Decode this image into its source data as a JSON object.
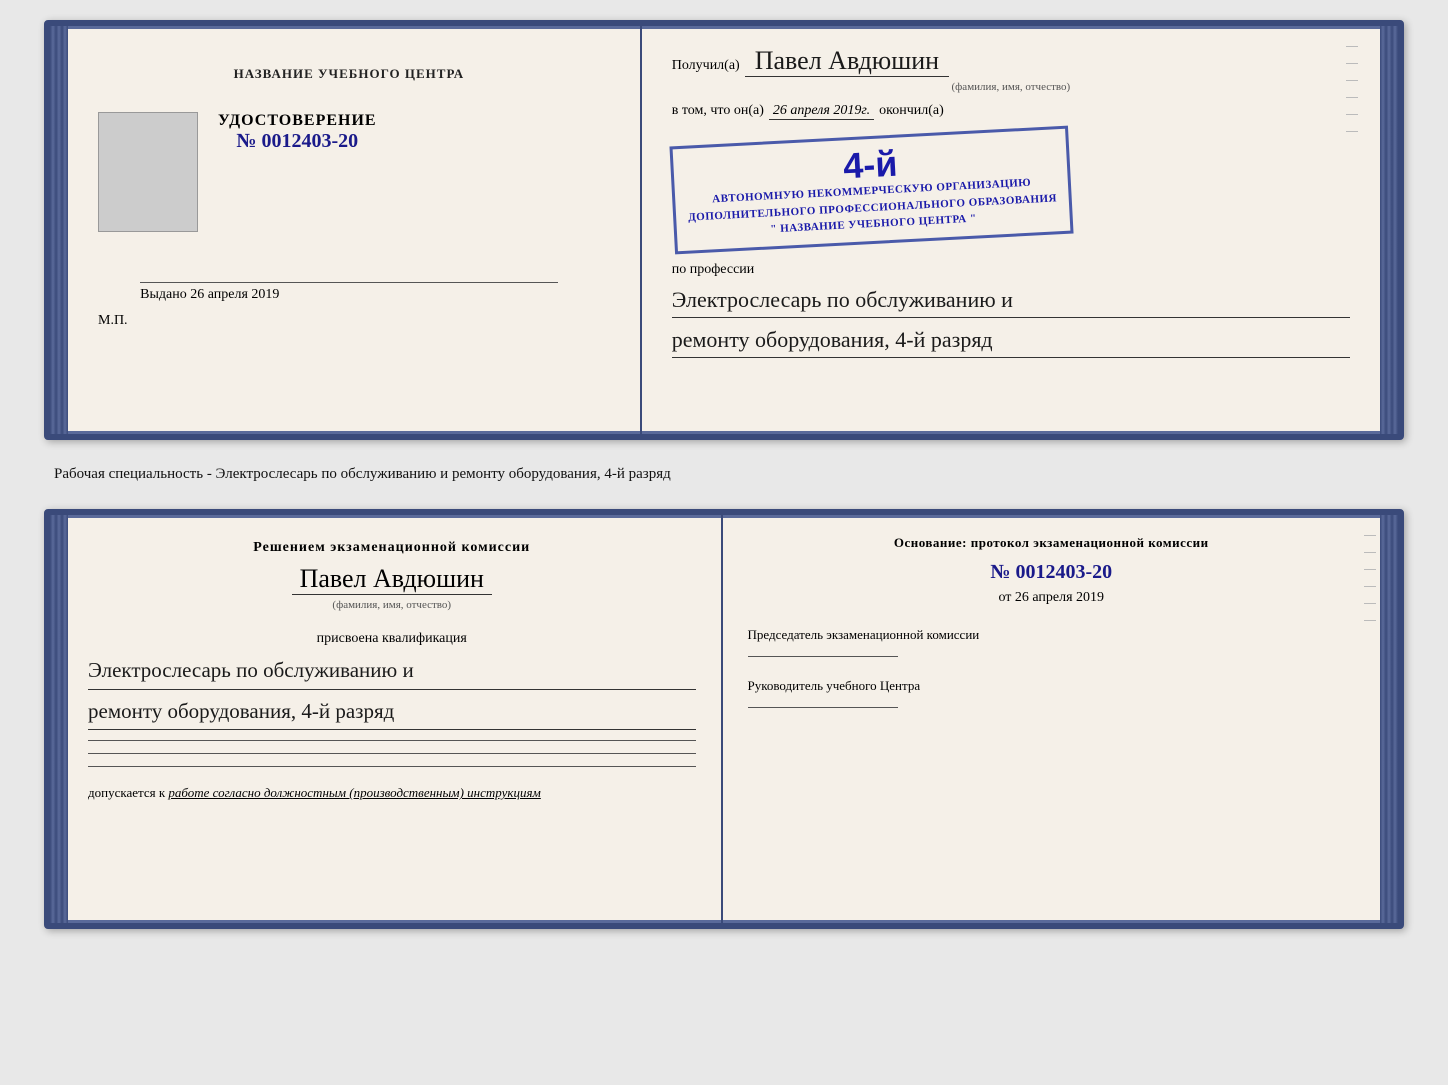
{
  "top_card": {
    "left": {
      "center_title": "НАЗВАНИЕ УЧЕБНОГО ЦЕНТРА",
      "udostoverenie_title": "УДОСТОВЕРЕНИЕ",
      "udostoverenie_number": "№ 0012403-20",
      "vydano_label": "Выдано",
      "vydano_date": "26 апреля 2019",
      "mp_label": "М.П."
    },
    "right": {
      "poluchil_label": "Получил(а)",
      "recipient_name": "Павел Авдюшин",
      "fio_label": "(фамилия, имя, отчество)",
      "vtom_label": "в том, что он(а)",
      "vtom_date": "26 апреля 2019г.",
      "okonchil_label": "окончил(а)",
      "stamp_grade": "4-й",
      "stamp_line1": "АВТОНОМНУЮ НЕКОММЕРЧЕСКУЮ ОРГАНИЗАЦИЮ",
      "stamp_line2": "ДОПОЛНИТЕЛЬНОГО ПРОФЕССИОНАЛЬНОГО ОБРАЗОВАНИЯ",
      "stamp_line3": "\" НАЗВАНИЕ УЧЕБНОГО ЦЕНТРА \"",
      "po_professii_label": "по профессии",
      "profession_line1": "Электрослесарь по обслуживанию и",
      "profession_line2": "ремонту оборудования, 4-й разряд"
    }
  },
  "specialty_text": "Рабочая специальность - Электрослесарь по обслуживанию и ремонту оборудования, 4-й разряд",
  "bottom_card": {
    "left": {
      "resheniem_title": "Решением экзаменационной комиссии",
      "recipient_name": "Павел Авдюшин",
      "fio_label": "(фамилия, имя, отчество)",
      "prisvoena_label": "присвоена квалификация",
      "kvalif_line1": "Электрослесарь по обслуживанию и",
      "kvalif_line2": "ремонту оборудования, 4-й разряд",
      "dopuskaetsya_label": "допускается к",
      "dopuskaetsya_value": "работе согласно должностным (производственным) инструкциям"
    },
    "right": {
      "osnovanie_title": "Основание: протокол экзаменационной комиссии",
      "protocol_number": "№ 0012403-20",
      "ot_label": "от",
      "ot_date": "26 апреля 2019",
      "predsedatel_label": "Председатель экзаменационной комиссии",
      "rukovoditel_label": "Руководитель учебного Центра"
    }
  }
}
